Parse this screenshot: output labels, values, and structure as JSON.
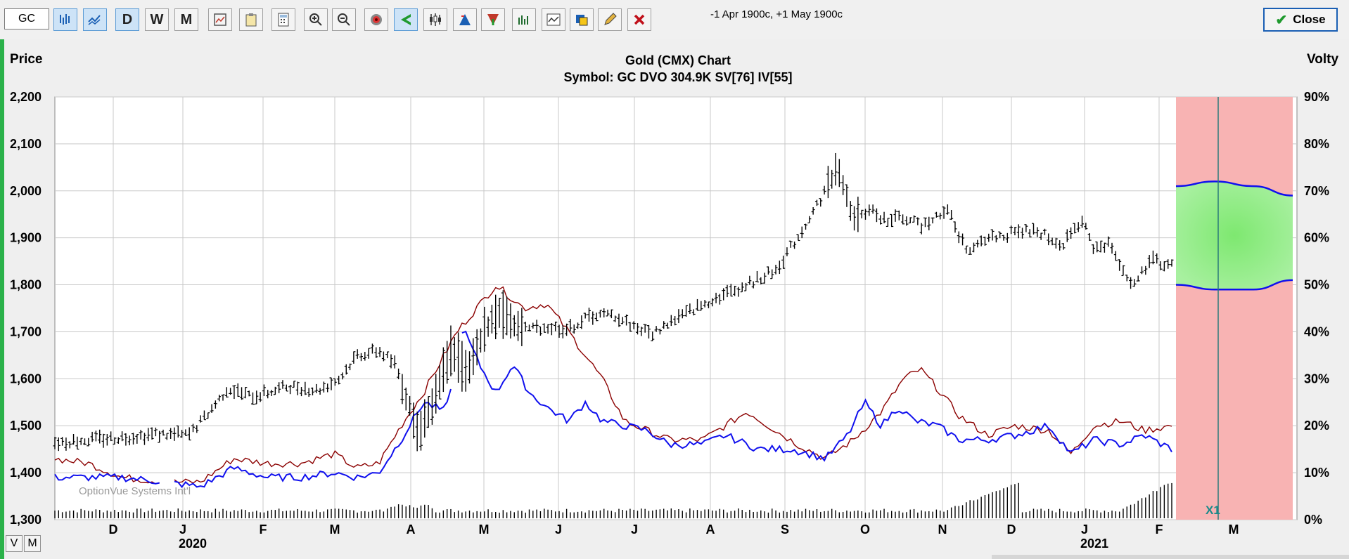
{
  "toolbar": {
    "symbol_value": "GC",
    "date_range": "-1 Apr 1900c, +1 May 1900c",
    "close_label": "Close",
    "period_buttons": [
      "D",
      "W",
      "M"
    ],
    "icons": [
      "bar-chart-icon",
      "line-chart-icon",
      "daily-button",
      "weekly-button",
      "monthly-button",
      "chart-settings-icon",
      "clipboard-icon",
      "calculator-icon",
      "zoom-in-icon",
      "zoom-out-icon",
      "target-icon",
      "arrow-left-icon",
      "candlestick-icon",
      "triangle-up-icon",
      "triangle-down-icon",
      "study-icon",
      "indicator-icon",
      "palette-icon",
      "pencil-icon",
      "delete-icon"
    ]
  },
  "bottom": {
    "v_label": "V",
    "m_label": "M"
  },
  "chart_data": {
    "type": "line",
    "title": "Gold (CMX) Chart",
    "subtitle": "Symbol: GC  DVO 304.9K  SV[76]  IV[55]",
    "left_axis_title": "Price",
    "right_axis_title": "Volty",
    "watermark": "OptionVue Systems Int'l",
    "marker_label": "X1",
    "ylim": [
      1300,
      2200
    ],
    "y2lim": [
      0,
      90
    ],
    "y_ticks": [
      "1,300",
      "1,400",
      "1,500",
      "1,600",
      "1,700",
      "1,800",
      "1,900",
      "2,000",
      "2,100",
      "2,200"
    ],
    "y2_ticks": [
      "0%",
      "10%",
      "20%",
      "30%",
      "40%",
      "50%",
      "60%",
      "70%",
      "80%",
      "90%"
    ],
    "x_month_labels": [
      "D",
      "J",
      "F",
      "M",
      "A",
      "M",
      "J",
      "J",
      "A",
      "S",
      "O",
      "N",
      "D",
      "J",
      "F",
      "M"
    ],
    "x_year_labels": [
      {
        "label": "2020",
        "under_month_index": 1
      },
      {
        "label": "2021",
        "under_month_index": 13
      }
    ],
    "grid": true,
    "price_series": {
      "name": "price bars",
      "color": "#000000",
      "anchors": [
        {
          "t": 0,
          "v": 1465
        },
        {
          "t": 0.06,
          "v": 1475
        },
        {
          "t": 0.09,
          "v": 1482
        },
        {
          "t": 0.12,
          "v": 1480
        },
        {
          "t": 0.135,
          "v": 1520
        },
        {
          "t": 0.155,
          "v": 1580
        },
        {
          "t": 0.175,
          "v": 1562
        },
        {
          "t": 0.19,
          "v": 1570
        },
        {
          "t": 0.21,
          "v": 1585
        },
        {
          "t": 0.235,
          "v": 1575
        },
        {
          "t": 0.255,
          "v": 1600
        },
        {
          "t": 0.27,
          "v": 1650
        },
        {
          "t": 0.29,
          "v": 1660
        },
        {
          "t": 0.305,
          "v": 1630
        },
        {
          "t": 0.325,
          "v": 1480
        },
        {
          "t": 0.34,
          "v": 1560
        },
        {
          "t": 0.355,
          "v": 1670
        },
        {
          "t": 0.37,
          "v": 1610
        },
        {
          "t": 0.385,
          "v": 1710
        },
        {
          "t": 0.4,
          "v": 1740
        },
        {
          "t": 0.415,
          "v": 1705
        },
        {
          "t": 0.44,
          "v": 1710
        },
        {
          "t": 0.46,
          "v": 1705
        },
        {
          "t": 0.48,
          "v": 1735
        },
        {
          "t": 0.5,
          "v": 1735
        },
        {
          "t": 0.52,
          "v": 1710
        },
        {
          "t": 0.535,
          "v": 1695
        },
        {
          "t": 0.55,
          "v": 1720
        },
        {
          "t": 0.57,
          "v": 1745
        },
        {
          "t": 0.59,
          "v": 1770
        },
        {
          "t": 0.62,
          "v": 1800
        },
        {
          "t": 0.645,
          "v": 1830
        },
        {
          "t": 0.665,
          "v": 1900
        },
        {
          "t": 0.685,
          "v": 1980
        },
        {
          "t": 0.7,
          "v": 2050
        },
        {
          "t": 0.715,
          "v": 1940
        },
        {
          "t": 0.73,
          "v": 1960
        },
        {
          "t": 0.745,
          "v": 1935
        },
        {
          "t": 0.76,
          "v": 1945
        },
        {
          "t": 0.775,
          "v": 1925
        },
        {
          "t": 0.79,
          "v": 1950
        },
        {
          "t": 0.8,
          "v": 1960
        },
        {
          "t": 0.81,
          "v": 1900
        },
        {
          "t": 0.82,
          "v": 1870
        },
        {
          "t": 0.835,
          "v": 1900
        },
        {
          "t": 0.85,
          "v": 1905
        },
        {
          "t": 0.865,
          "v": 1915
        },
        {
          "t": 0.885,
          "v": 1910
        },
        {
          "t": 0.9,
          "v": 1880
        },
        {
          "t": 0.91,
          "v": 1910
        },
        {
          "t": 0.92,
          "v": 1935
        },
        {
          "t": 0.93,
          "v": 1880
        },
        {
          "t": 0.945,
          "v": 1885
        },
        {
          "t": 0.955,
          "v": 1840
        },
        {
          "t": 0.965,
          "v": 1795
        },
        {
          "t": 0.975,
          "v": 1830
        },
        {
          "t": 0.985,
          "v": 1855
        },
        {
          "t": 0.995,
          "v": 1840
        },
        {
          "t": 1.0,
          "v": 1845
        }
      ]
    },
    "projection": {
      "upper_pct": [
        71,
        72,
        71,
        69
      ],
      "lower_pct": [
        50,
        49,
        49,
        51
      ],
      "band_color": "#f8b3b3",
      "cone_color": "#a8f0a0",
      "line_color": "#1010ee"
    },
    "series": [
      {
        "name": "statistical volatility",
        "color": "#8b0000",
        "anchors_pct": [
          {
            "t": 0,
            "v": 13
          },
          {
            "t": 0.03,
            "v": 12
          },
          {
            "t": 0.06,
            "v": 9
          },
          {
            "t": 0.1,
            "v": 8
          },
          {
            "t": 0.13,
            "v": 8
          },
          {
            "t": 0.16,
            "v": 13
          },
          {
            "t": 0.19,
            "v": 12
          },
          {
            "t": 0.22,
            "v": 12
          },
          {
            "t": 0.25,
            "v": 14
          },
          {
            "t": 0.27,
            "v": 11
          },
          {
            "t": 0.29,
            "v": 12
          },
          {
            "t": 0.31,
            "v": 20
          },
          {
            "t": 0.33,
            "v": 27
          },
          {
            "t": 0.36,
            "v": 40
          },
          {
            "t": 0.395,
            "v": 50
          },
          {
            "t": 0.42,
            "v": 45
          },
          {
            "t": 0.44,
            "v": 46
          },
          {
            "t": 0.46,
            "v": 40
          },
          {
            "t": 0.49,
            "v": 30
          },
          {
            "t": 0.51,
            "v": 21
          },
          {
            "t": 0.53,
            "v": 19
          },
          {
            "t": 0.55,
            "v": 17
          },
          {
            "t": 0.58,
            "v": 17
          },
          {
            "t": 0.6,
            "v": 20
          },
          {
            "t": 0.62,
            "v": 23
          },
          {
            "t": 0.645,
            "v": 19
          },
          {
            "t": 0.665,
            "v": 16
          },
          {
            "t": 0.69,
            "v": 13
          },
          {
            "t": 0.715,
            "v": 17
          },
          {
            "t": 0.74,
            "v": 23
          },
          {
            "t": 0.76,
            "v": 30
          },
          {
            "t": 0.775,
            "v": 32
          },
          {
            "t": 0.79,
            "v": 28
          },
          {
            "t": 0.81,
            "v": 22
          },
          {
            "t": 0.835,
            "v": 18
          },
          {
            "t": 0.86,
            "v": 20
          },
          {
            "t": 0.89,
            "v": 19
          },
          {
            "t": 0.91,
            "v": 14
          },
          {
            "t": 0.93,
            "v": 20
          },
          {
            "t": 0.955,
            "v": 21
          },
          {
            "t": 0.975,
            "v": 19
          },
          {
            "t": 1.0,
            "v": 20
          }
        ]
      },
      {
        "name": "implied volatility",
        "color": "#1010ee",
        "anchors_pct": [
          {
            "t": 0,
            "v": 9
          },
          {
            "t": 0.03,
            "v": 9
          },
          {
            "t": 0.06,
            "v": 9
          },
          {
            "t": 0.1,
            "v": 8
          },
          {
            "t": 0.13,
            "v": 7
          },
          {
            "t": 0.16,
            "v": 11
          },
          {
            "t": 0.19,
            "v": 9
          },
          {
            "t": 0.22,
            "v": 9
          },
          {
            "t": 0.25,
            "v": 10
          },
          {
            "t": 0.27,
            "v": 9
          },
          {
            "t": 0.29,
            "v": 10
          },
          {
            "t": 0.31,
            "v": 17
          },
          {
            "t": 0.33,
            "v": 25
          },
          {
            "t": 0.35,
            "v": 23
          },
          {
            "t": 0.365,
            "v": 41
          },
          {
            "t": 0.38,
            "v": 33
          },
          {
            "t": 0.395,
            "v": 27
          },
          {
            "t": 0.41,
            "v": 33
          },
          {
            "t": 0.425,
            "v": 27
          },
          {
            "t": 0.44,
            "v": 24
          },
          {
            "t": 0.46,
            "v": 21
          },
          {
            "t": 0.475,
            "v": 25
          },
          {
            "t": 0.49,
            "v": 21
          },
          {
            "t": 0.51,
            "v": 20
          },
          {
            "t": 0.53,
            "v": 19
          },
          {
            "t": 0.55,
            "v": 16
          },
          {
            "t": 0.58,
            "v": 16
          },
          {
            "t": 0.6,
            "v": 18
          },
          {
            "t": 0.63,
            "v": 15
          },
          {
            "t": 0.66,
            "v": 15
          },
          {
            "t": 0.69,
            "v": 13
          },
          {
            "t": 0.71,
            "v": 18
          },
          {
            "t": 0.725,
            "v": 25
          },
          {
            "t": 0.74,
            "v": 20
          },
          {
            "t": 0.755,
            "v": 24
          },
          {
            "t": 0.77,
            "v": 21
          },
          {
            "t": 0.79,
            "v": 20
          },
          {
            "t": 0.81,
            "v": 17
          },
          {
            "t": 0.835,
            "v": 17
          },
          {
            "t": 0.86,
            "v": 18
          },
          {
            "t": 0.89,
            "v": 20
          },
          {
            "t": 0.91,
            "v": 14
          },
          {
            "t": 0.93,
            "v": 17
          },
          {
            "t": 0.955,
            "v": 16
          },
          {
            "t": 0.975,
            "v": 18
          },
          {
            "t": 1.0,
            "v": 15
          }
        ]
      }
    ],
    "volume": {
      "color": "#000000",
      "spikes": [
        {
          "t_from": 0.8,
          "t_to": 0.865,
          "peak": 1.0
        },
        {
          "t_from": 0.955,
          "t_to": 1.0,
          "peak": 1.0
        }
      ]
    }
  }
}
